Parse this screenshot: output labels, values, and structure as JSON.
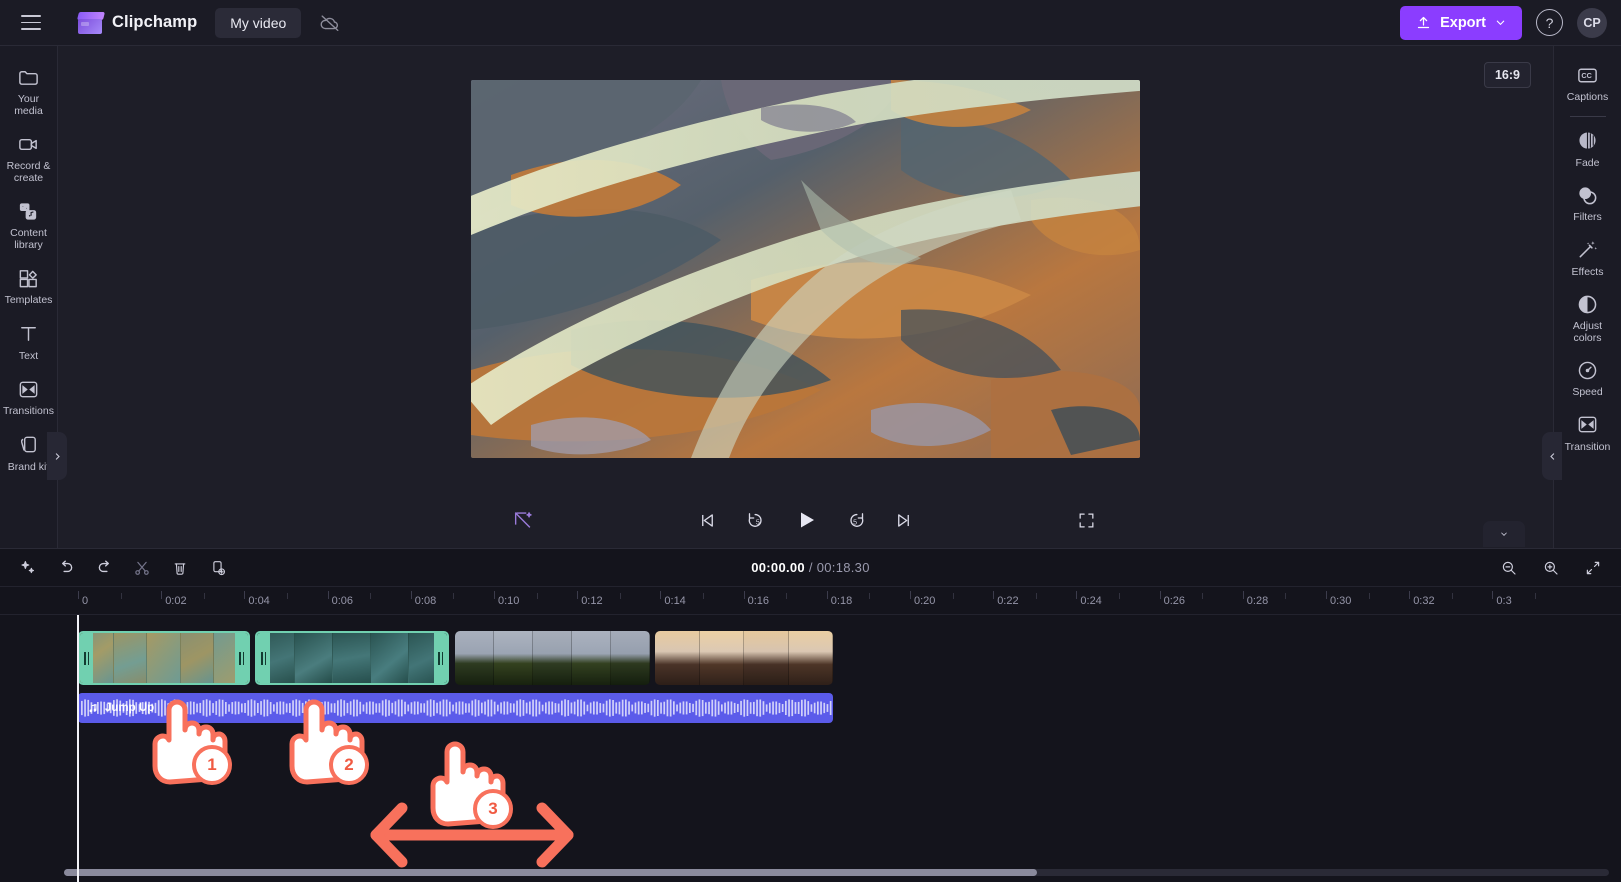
{
  "topbar": {
    "menu_icon": "hamburger-menu-icon",
    "brand_name": "Clipchamp",
    "project_name": "My video",
    "cloud_icon": "cloud-off-icon",
    "export_label": "Export",
    "export_icon": "upload-icon",
    "export_caret": "chevron-down-icon",
    "help_label": "?",
    "avatar_initials": "CP",
    "accent_color": "#8b3dff"
  },
  "left_sidebar": {
    "items": [
      {
        "label": "Your media",
        "icon": "folder-icon"
      },
      {
        "label": "Record &\ncreate",
        "icon": "video-camera-icon"
      },
      {
        "label": "Content\nlibrary",
        "icon": "content-library-icon"
      },
      {
        "label": "Templates",
        "icon": "templates-icon"
      },
      {
        "label": "Text",
        "icon": "text-icon"
      },
      {
        "label": "Transitions",
        "icon": "transitions-icon"
      },
      {
        "label": "Brand kit",
        "icon": "brand-kit-icon"
      }
    ],
    "collapse_icon": "chevron-right-icon"
  },
  "right_sidebar": {
    "items": [
      {
        "label": "Captions",
        "icon": "closed-captions-icon"
      },
      {
        "label": "Fade",
        "icon": "fade-icon"
      },
      {
        "label": "Filters",
        "icon": "filters-icon"
      },
      {
        "label": "Effects",
        "icon": "magic-wand-effects-icon"
      },
      {
        "label": "Adjust\ncolors",
        "icon": "adjust-colors-icon"
      },
      {
        "label": "Speed",
        "icon": "speedometer-icon"
      },
      {
        "label": "Transition",
        "icon": "transition-icon"
      }
    ],
    "collapse_icon": "chevron-left-icon"
  },
  "stage": {
    "aspect_ratio": "16:9",
    "preview_alt": "aerial-river-delta-video-frame"
  },
  "player": {
    "autofix_icon": "auto-fix-disabled-icon",
    "controls": [
      {
        "name": "skip-to-start-button",
        "icon": "skip-start-icon"
      },
      {
        "name": "rewind-5-seconds-button",
        "icon": "rewind-5-icon"
      },
      {
        "name": "play-button",
        "icon": "play-icon"
      },
      {
        "name": "forward-5-seconds-button",
        "icon": "forward-5-icon"
      },
      {
        "name": "skip-to-end-button",
        "icon": "skip-end-icon"
      }
    ],
    "fullscreen_icon": "fullscreen-icon"
  },
  "timeline": {
    "collapse_chevron": "chevron-down-icon",
    "toolbar": [
      {
        "name": "magic-suggestion-button",
        "icon": "sparkle-icon"
      },
      {
        "name": "undo-button",
        "icon": "undo-icon"
      },
      {
        "name": "redo-button",
        "icon": "redo-icon"
      },
      {
        "name": "split-button",
        "icon": "scissors-icon"
      },
      {
        "name": "delete-button",
        "icon": "trash-icon"
      },
      {
        "name": "duplicate-button",
        "icon": "duplicate-icon"
      }
    ],
    "current_time": "00:00.00",
    "separator": "/",
    "total_time": "00:18.30",
    "zoom_out_icon": "zoom-out-icon",
    "zoom_in_icon": "zoom-in-icon",
    "fit_icon": "fit-to-timeline-icon",
    "ruler_labels": [
      "0",
      "0:02",
      "0:04",
      "0:06",
      "0:08",
      "0:10",
      "0:12",
      "0:14",
      "0:16",
      "0:18",
      "0:20",
      "0:22",
      "0:24",
      "0:26",
      "0:28",
      "0:30",
      "0:32",
      "0:3"
    ],
    "video_clips": [
      {
        "name": "clip-1",
        "selected": true,
        "label": ""
      },
      {
        "name": "clip-2",
        "selected": true,
        "label": ""
      },
      {
        "name": "clip-3",
        "selected": false,
        "label": ""
      },
      {
        "name": "clip-4",
        "selected": false,
        "label": ""
      }
    ],
    "audio_clip": {
      "name": "audio-clip",
      "label": "Jump Up",
      "icon": "music-note-icon",
      "color": "#5b5bea"
    },
    "playhead_position": "0"
  },
  "annotations": {
    "badges": [
      "1",
      "2",
      "3"
    ],
    "arrow": "double-headed-drag-arrow",
    "color": "#f8715c"
  }
}
